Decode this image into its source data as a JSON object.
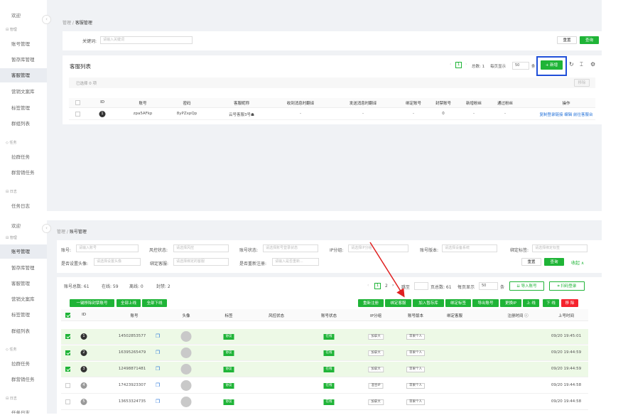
{
  "top": {
    "sidebar": {
      "welcome": "欢迎",
      "group_manage": "管理",
      "items": [
        "账号管理",
        "暂存库管理",
        "客服管理",
        "营销文案库",
        "标签管理",
        "群组列表"
      ],
      "group_task": "任务",
      "task_items": [
        "拉群任务",
        "群营销任务"
      ],
      "group_log": "日志",
      "log_items": [
        "任务日志"
      ]
    },
    "breadcrumb_root": "管理",
    "breadcrumb_current": "客服管理",
    "keyword_label": "关键词:",
    "keyword_placeholder": "请输入关键词",
    "reset_label": "重置",
    "search_label": "查询",
    "list_title": "客服列表",
    "pagination": {
      "current": "1",
      "total_text": "总数: 1",
      "per_page_label": "每页显示",
      "per_page": "50",
      "suffix": "条"
    },
    "new_label": "+ 新增",
    "selected_text": "已选择 0 项",
    "delete_label": "移除",
    "columns": [
      "ID",
      "账号",
      "密码",
      "客服昵称",
      "收到消息时翻译",
      "发送消息时翻译",
      "绑定账号",
      "封禁账号",
      "新增粉丝",
      "通过粉丝",
      "操作"
    ],
    "rows": [
      {
        "id": "1",
        "account": "zpa5AFkp",
        "password": "8yPZxpQp",
        "nickname": "云号客服3号",
        "recv": "-",
        "send": "-",
        "bound": "-",
        "banned": "0",
        "new_fans": "-",
        "passed": "-",
        "actions": "复制登录链接 编辑 前往客服台"
      }
    ]
  },
  "bottom": {
    "sidebar": {
      "welcome": "欢迎",
      "group_manage": "管理",
      "items": [
        "账号管理",
        "暂存库管理",
        "客服管理",
        "营销文案库",
        "标签管理",
        "群组列表"
      ],
      "group_task": "任务",
      "task_items": [
        "拉群任务",
        "群营销任务"
      ],
      "group_log": "日志",
      "log_items": [
        "任务日志"
      ]
    },
    "breadcrumb_root": "管理",
    "breadcrumb_current": "账号管理",
    "filters": {
      "account_label": "账号:",
      "account_ph": "请输入账号",
      "risk_label": "风控状态:",
      "risk_ph": "请选择风控",
      "status_label": "账号状态:",
      "status_ph": "请选择账号登录状态",
      "ip_label": "IP分组:",
      "ip_ph": "请选择IP分组",
      "version_label": "账号版本:",
      "version_ph": "请选择设备系统",
      "bindtag_label": "绑定标签:",
      "bindtag_ph": "请选择绑定标签",
      "avatar_label": "是否设置头像:",
      "avatar_ph": "请选择设置头像",
      "cs_label": "绑定客服:",
      "cs_ph": "请选择绑定的客服",
      "rereg_label": "是否重新注册:",
      "rereg_ph": "请输入是否重新...",
      "reset": "重置",
      "search": "查询",
      "collapse": "收起 ∧"
    },
    "stats": {
      "total": "账号总数: 61",
      "online": "在线: 59",
      "offline": "离线: 0",
      "banned": "封禁: 2"
    },
    "pagination": {
      "page1": "1",
      "page2": "2",
      "jump": "跳至",
      "total": "页总数: 61",
      "per_page_label": "每页显示",
      "per_page": "50",
      "suffix": "条"
    },
    "import_label": "导入账号",
    "scan_label": "扫码登录",
    "left_actions": [
      "一键移除封禁账号",
      "全部上线",
      "全部下线"
    ],
    "right_actions": [
      "重新注册",
      "绑定客服",
      "加入暂存库",
      "绑定标签",
      "导出账号",
      "更换IP",
      "上 线",
      "下 线",
      "移 除"
    ],
    "columns": [
      "ID",
      "账号",
      "头像",
      "标签",
      "风控状态",
      "账号状态",
      "IP分组",
      "账号版本",
      "绑定客服",
      "注册时间 ⓘ",
      "上号时间"
    ],
    "rows": [
      {
        "id": "1",
        "phone": "14502853577",
        "tag": "协议",
        "status": "在线",
        "ip": "加拿大",
        "version": "苹果个人",
        "time": "09/20 19:45:01",
        "checked": true
      },
      {
        "id": "2",
        "phone": "16395265479",
        "tag": "协议",
        "status": "在线",
        "ip": "加拿大",
        "version": "苹果个人",
        "time": "09/20 19:44:59",
        "checked": true
      },
      {
        "id": "3",
        "phone": "12498871481",
        "tag": "协议",
        "status": "在线",
        "ip": "加拿大",
        "version": "苹果个人",
        "time": "09/20 19:44:59",
        "checked": true
      },
      {
        "id": "4",
        "phone": "17423923307",
        "tag": "协议",
        "status": "在线",
        "ip": "混合IP",
        "version": "苹果个人",
        "time": "09/20 19:44:58",
        "checked": false
      },
      {
        "id": "5",
        "phone": "13653324735",
        "tag": "协议",
        "status": "在线",
        "ip": "加拿大",
        "version": "苹果个人",
        "time": "09/20 19:44:58",
        "checked": false
      }
    ]
  },
  "colors": {
    "green": "#1fb437",
    "highlight": "#1f4fd8",
    "arrow": "#e02020",
    "red": "#f5222d"
  }
}
